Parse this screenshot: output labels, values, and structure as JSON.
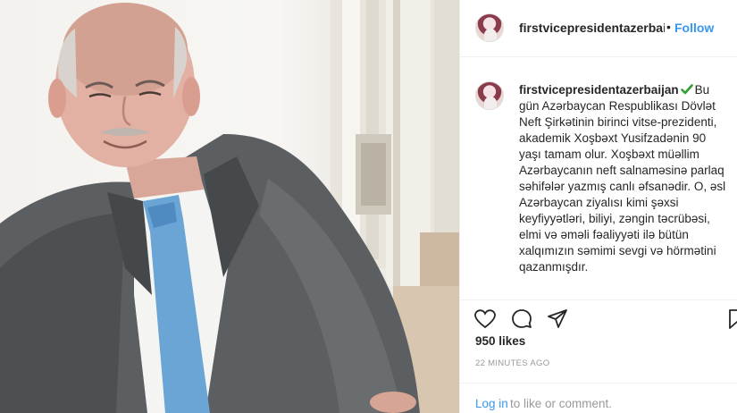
{
  "post": {
    "photo_alt": "",
    "username": "firstvicepresidentazerbaijan",
    "header_username_display": "firstvicepresidentazerbaij",
    "separator": "•",
    "follow_label": "Follow",
    "caption_lines": [
      "Bu",
      "gün Azərbaycan Respublikası Dövlət",
      "Neft Şirkətinin birinci vitse-prezidenti,",
      "akademik Xoşbəxt Yusifzadənin 90",
      "yaşı tamam olur. Xoşbəxt müəllim",
      "Azərbaycanın neft salnaməsinə parlaq",
      "səhifələr yazmış canlı əfsanədir. O, əsl",
      "Azərbaycan ziyalısı kimi şəxsi",
      "keyfiyyətləri, biliyi, zəngin təcrübəsi,",
      "elmi və əməli fəaliyyəti ilə bütün",
      "xalqımızın səmimi sevgi və hörmətini",
      "qazanmışdır."
    ],
    "likes": "950 likes",
    "timestamp": "22 MINUTES AGO",
    "login_link": "Log in",
    "login_rest": "to like or comment.",
    "icons": {
      "like": "heart-icon",
      "comment": "comment-icon",
      "share": "share-icon",
      "save": "bookmark-icon",
      "verified": "verified-check-icon"
    },
    "colors": {
      "link": "#3897f0",
      "text": "#262626",
      "muted": "#999999",
      "verified": "#2e9e2e"
    }
  }
}
